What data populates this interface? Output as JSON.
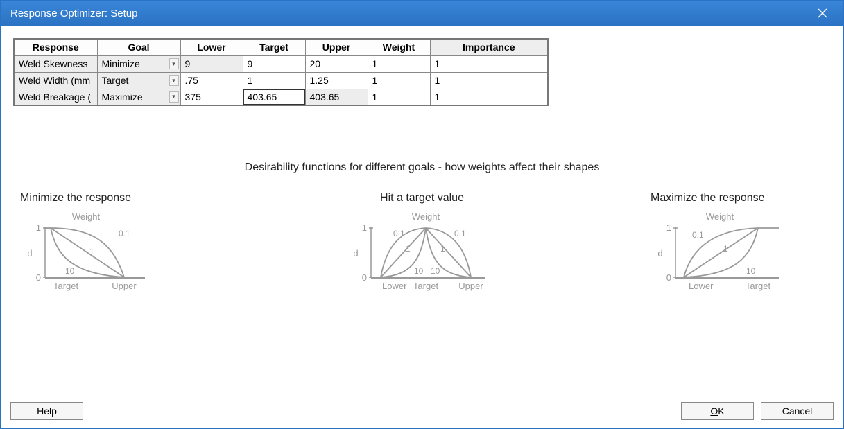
{
  "window": {
    "title": "Response Optimizer: Setup"
  },
  "table": {
    "headers": {
      "response": "Response",
      "goal": "Goal",
      "lower": "Lower",
      "target": "Target",
      "upper": "Upper",
      "weight": "Weight",
      "importance": "Importance"
    },
    "rows": [
      {
        "response": "Weld Skewness",
        "goal": "Minimize",
        "lower": "9",
        "target": "9",
        "upper": "20",
        "weight": "1",
        "importance": "1"
      },
      {
        "response": "Weld Width (mm",
        "goal": "Target",
        "lower": ".75",
        "target": "1",
        "upper": "1.25",
        "weight": "1",
        "importance": "1"
      },
      {
        "response": "Weld Breakage (",
        "goal": "Maximize",
        "lower": "375",
        "target": "403.65",
        "upper": "403.65",
        "weight": "1",
        "importance": "1"
      }
    ],
    "selected_cell": {
      "row": 2,
      "col": "target"
    }
  },
  "desirability": {
    "section_title": "Desirability functions for different goals - how weights affect their shapes",
    "charts": {
      "minimize": {
        "title": "Minimize the response",
        "weight_label": "Weight",
        "d_label": "d",
        "y_ticks": [
          "0",
          "1"
        ],
        "x_ticks": [
          "Target",
          "Upper"
        ],
        "curve_labels": [
          "0.1",
          "1",
          "10"
        ]
      },
      "target": {
        "title": "Hit a target value",
        "weight_label": "Weight",
        "d_label": "d",
        "y_ticks": [
          "0",
          "1"
        ],
        "x_ticks": [
          "Lower",
          "Target",
          "Upper"
        ],
        "curve_labels": [
          "0.1",
          "1",
          "10",
          "10",
          "1",
          "0.1"
        ]
      },
      "maximize": {
        "title": "Maximize the response",
        "weight_label": "Weight",
        "d_label": "d",
        "y_ticks": [
          "0",
          "1"
        ],
        "x_ticks": [
          "Lower",
          "Target"
        ],
        "curve_labels": [
          "0.1",
          "1",
          "10"
        ]
      }
    }
  },
  "buttons": {
    "help": "Help",
    "ok_prefix": "O",
    "ok_rest": "K",
    "cancel": "Cancel"
  },
  "chart_data": [
    {
      "type": "line",
      "title": "Minimize the response",
      "xlabel": "",
      "ylabel": "d",
      "xlim": [
        0,
        1
      ],
      "ylim": [
        0,
        1
      ],
      "x_categories": [
        "Target",
        "Upper"
      ],
      "series": [
        {
          "name": "0.1",
          "x": [
            0,
            0.2,
            0.5,
            0.8,
            1
          ],
          "y": [
            1,
            0.95,
            0.85,
            0.55,
            0
          ]
        },
        {
          "name": "1",
          "x": [
            0,
            1
          ],
          "y": [
            1,
            0
          ]
        },
        {
          "name": "10",
          "x": [
            0,
            0.15,
            0.3,
            0.6,
            1
          ],
          "y": [
            1,
            0.5,
            0.2,
            0.05,
            0
          ]
        }
      ]
    },
    {
      "type": "line",
      "title": "Hit a target value",
      "xlabel": "",
      "ylabel": "d",
      "xlim": [
        0,
        1
      ],
      "ylim": [
        0,
        1
      ],
      "x_categories": [
        "Lower",
        "Target",
        "Upper"
      ],
      "series": [
        {
          "name": "0.1 left",
          "x": [
            0,
            0.1,
            0.25,
            0.4,
            0.5
          ],
          "y": [
            0,
            0.6,
            0.85,
            0.95,
            1
          ]
        },
        {
          "name": "1 left",
          "x": [
            0,
            0.5
          ],
          "y": [
            0,
            1
          ]
        },
        {
          "name": "10 left",
          "x": [
            0,
            0.3,
            0.42,
            0.47,
            0.5
          ],
          "y": [
            0,
            0.05,
            0.25,
            0.6,
            1
          ]
        },
        {
          "name": "10 right",
          "x": [
            0.5,
            0.53,
            0.58,
            0.7,
            1
          ],
          "y": [
            1,
            0.6,
            0.25,
            0.05,
            0
          ]
        },
        {
          "name": "1 right",
          "x": [
            0.5,
            1
          ],
          "y": [
            1,
            0
          ]
        },
        {
          "name": "0.1 right",
          "x": [
            0.5,
            0.6,
            0.75,
            0.9,
            1
          ],
          "y": [
            1,
            0.95,
            0.85,
            0.6,
            0
          ]
        }
      ]
    },
    {
      "type": "line",
      "title": "Maximize the response",
      "xlabel": "",
      "ylabel": "d",
      "xlim": [
        0,
        1
      ],
      "ylim": [
        0,
        1
      ],
      "x_categories": [
        "Lower",
        "Target"
      ],
      "series": [
        {
          "name": "0.1",
          "x": [
            0,
            0.2,
            0.5,
            0.8,
            1
          ],
          "y": [
            0,
            0.55,
            0.85,
            0.95,
            1
          ]
        },
        {
          "name": "1",
          "x": [
            0,
            1
          ],
          "y": [
            0,
            1
          ]
        },
        {
          "name": "10",
          "x": [
            0,
            0.4,
            0.7,
            0.85,
            1
          ],
          "y": [
            0,
            0.05,
            0.2,
            0.5,
            1
          ]
        }
      ]
    }
  ]
}
